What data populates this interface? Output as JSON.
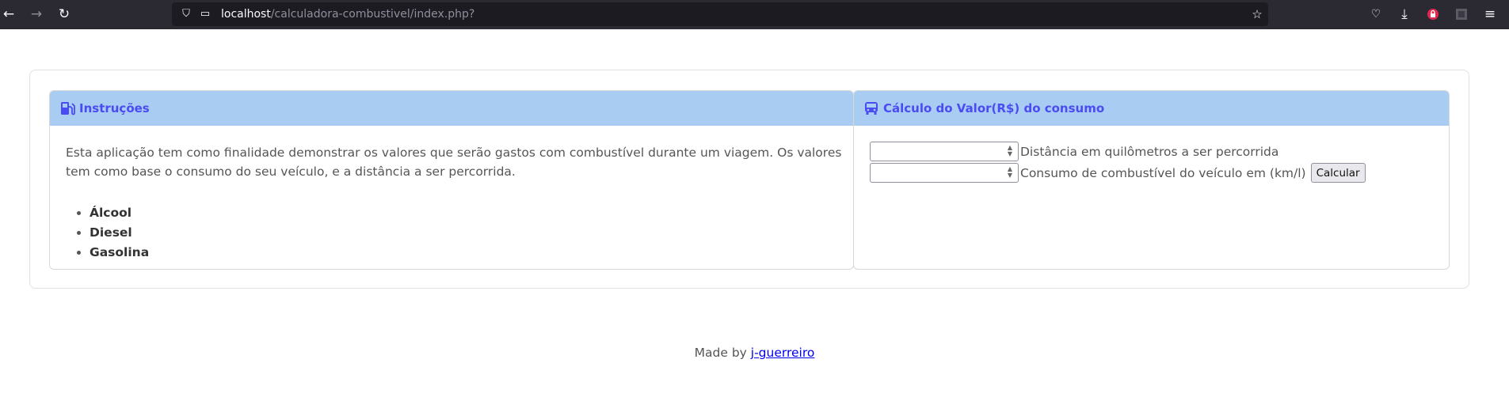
{
  "browser": {
    "url_host": "localhost",
    "url_path": "/calculadora-combustivel/index.php?",
    "back_icon": "arrow-left-icon",
    "forward_icon": "arrow-right-icon",
    "reload_icon": "reload-icon"
  },
  "instructions": {
    "title": "Instruções",
    "icon": "gas-pump-icon",
    "text": "Esta aplicação tem como finalidade demonstrar os valores que serão gastos com combustível durante um viagem. Os valores tem como base o consumo do seu veículo, e a distância a ser percorrida.",
    "fuels": [
      "Álcool",
      "Diesel",
      "Gasolina"
    ]
  },
  "calculator": {
    "title": "Cálculo do Valor(R$) do consumo",
    "icon": "bus-icon",
    "distance_label": "Distância em quilômetros a ser percorrida",
    "distance_value": "",
    "consumption_label": "Consumo de combustível do veículo em (km/l)",
    "consumption_value": "",
    "button_label": "Calcular"
  },
  "footer": {
    "prefix": "Made by",
    "link_text": "j-guerreiro"
  },
  "colors": {
    "header_bg": "#a9cdf2",
    "header_text": "#4b4bf2",
    "link": "#0000ee"
  }
}
